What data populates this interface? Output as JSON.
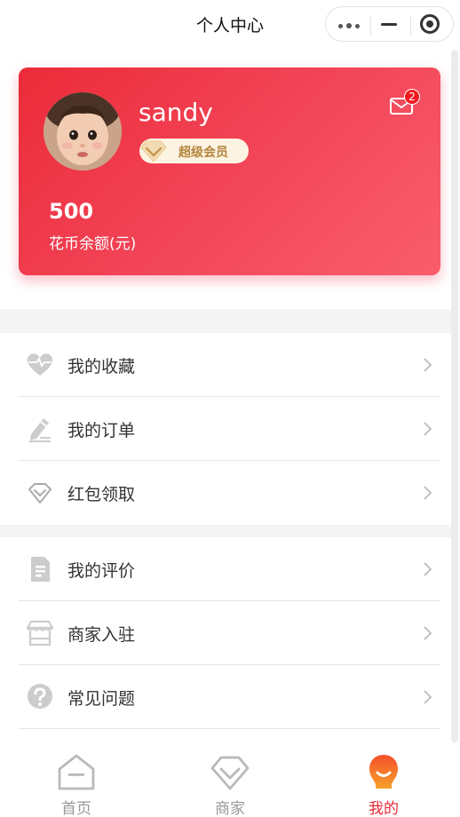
{
  "nav": {
    "title": "个人中心"
  },
  "profile": {
    "username": "sandy",
    "vip_label": "超级会员",
    "unread_count": "2",
    "balance_value": "500",
    "balance_label": "花币余额(元)"
  },
  "menu_group1": [
    {
      "label": "我的收藏",
      "icon": "heart-icon"
    },
    {
      "label": "我的订单",
      "icon": "pencil-icon"
    },
    {
      "label": "红包领取",
      "icon": "gift-icon"
    }
  ],
  "menu_group2": [
    {
      "label": "我的评价",
      "icon": "document-icon"
    },
    {
      "label": "商家入驻",
      "icon": "store-icon"
    },
    {
      "label": "常见问题",
      "icon": "question-icon"
    }
  ],
  "tabbar": [
    {
      "label": "首页",
      "icon": "home-icon",
      "active": false
    },
    {
      "label": "商家",
      "icon": "diamond-icon",
      "active": false
    },
    {
      "label": "我的",
      "icon": "profile-icon",
      "active": true
    }
  ],
  "colors": {
    "accent": "#e52a35",
    "card_start": "#ec2b39",
    "card_end": "#fa5d6b",
    "vip_text": "#b4853b"
  }
}
